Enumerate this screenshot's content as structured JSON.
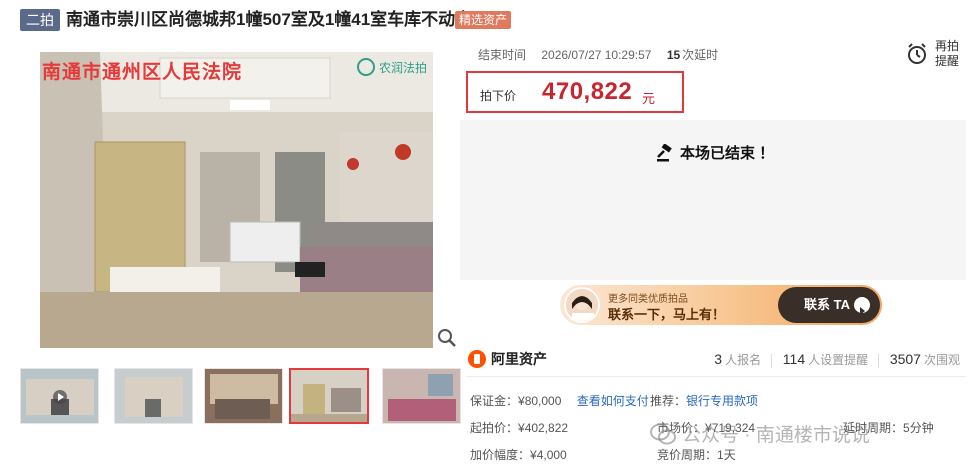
{
  "title_bar": {
    "round_tag": "二拍",
    "title": "南通市崇川区尚德城邦1幢507室及1幢41室车库不动产",
    "quality_tag": "精选资产"
  },
  "gallery": {
    "watermark_court": "南通市通州区人民法院",
    "logo_text": "农润法拍",
    "thumbnails": [
      "exterior-1",
      "exterior-2",
      "living-room-1",
      "living-room-2",
      "bedroom"
    ]
  },
  "auction": {
    "end_time_label": "结束时间",
    "end_time": "2026/07/27 10:29:57",
    "delay_count": "15",
    "delay_suffix": "次延时",
    "remind_label": "再拍提醒",
    "price_label": "拍下价",
    "price": "470,822",
    "price_unit": "元",
    "status": "本场已结束 ！"
  },
  "ad_banner": {
    "line1": "更多同类优质拍品",
    "line2": "联系一下，马上有！",
    "cta": "联系 TA"
  },
  "info": {
    "brand": "阿里资产",
    "signups_num": "3",
    "signups_label": "人报名",
    "reminders_num": "114",
    "reminders_label": "人设置提醒",
    "views_num": "3507",
    "views_label": "次围观",
    "deposit_label": "保证金：",
    "deposit_value": "¥80,000",
    "deposit_link": "查看如何支付",
    "recommend_label": "推荐：",
    "recommend_link": "银行专用款项",
    "start_label": "起拍价：",
    "start_value": "¥402,822",
    "market_label": "市场价：",
    "market_value": "¥719,324",
    "increment_label": "加价幅度：",
    "increment_value": "¥4,000",
    "delay_period_label": "延时周期：",
    "delay_period_value": "5分钟",
    "bid_period_label": "竞价周期：",
    "bid_period_value": "1天"
  },
  "overlay_watermark": "公众号 · 南通楼市说说",
  "colors": {
    "accent_red": "#c6262e",
    "border_red": "#e4393c",
    "tag_blue": "#5b6a8a",
    "tag_orange": "#e07a5f",
    "link_blue": "#2a6ac0",
    "brand_orange": "#ff5000"
  }
}
